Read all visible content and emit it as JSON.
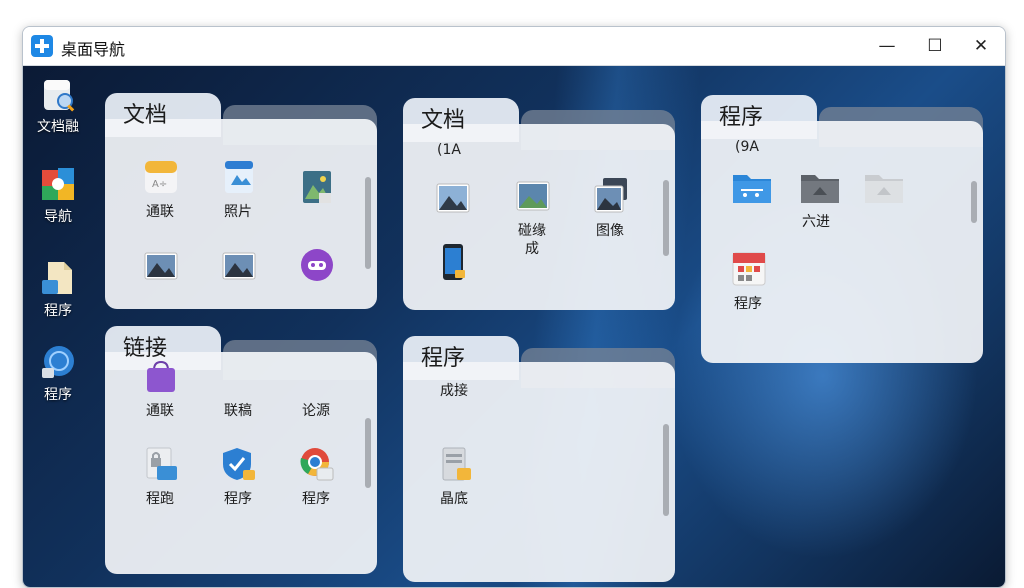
{
  "window": {
    "title": "桌面导航",
    "minimize_glyph": "—",
    "maximize_glyph": "☐",
    "close_glyph": "✕"
  },
  "sidebar": {
    "items": [
      {
        "label": "文档融",
        "icon": "folder-search-icon"
      },
      {
        "label": "导航",
        "icon": "colorful-app-icon"
      },
      {
        "label": "程序",
        "icon": "document-icon"
      },
      {
        "label": "程序",
        "icon": "globe-app-icon"
      }
    ]
  },
  "folders": [
    {
      "title": "文档",
      "subheader": "",
      "items": [
        {
          "label": "通联",
          "icon": "document-icon"
        },
        {
          "label": "照片",
          "icon": "photo-document-icon"
        },
        {
          "label": "",
          "icon": "photo-icon"
        },
        {
          "label": "",
          "icon": "landscape-image-icon"
        },
        {
          "label": "",
          "icon": "landscape-image-icon"
        },
        {
          "label": "",
          "icon": "game-controller-icon"
        }
      ]
    },
    {
      "title": "文档",
      "subheader": "(1A",
      "items": [
        {
          "label": "",
          "icon": "landscape-image-icon"
        },
        {
          "label": "碰缘\n成",
          "icon": "landscape-image-icon"
        },
        {
          "label": "图像",
          "icon": "stacked-images-icon"
        },
        {
          "label": "",
          "icon": "phone-icon"
        }
      ]
    },
    {
      "title": "程序",
      "subheader": "(9A",
      "items": [
        {
          "label": "",
          "icon": "blue-folder-icon"
        },
        {
          "label": "六进",
          "icon": "gray-folder-icon"
        },
        {
          "label": "",
          "icon": "light-folder-icon"
        },
        {
          "label": "程序",
          "icon": "calendar-app-icon"
        }
      ]
    },
    {
      "title": "链接",
      "subheader": "",
      "items": [
        {
          "label": "通联",
          "icon": "shopping-bag-icon"
        },
        {
          "label": "联稿",
          "icon": ""
        },
        {
          "label": "论源",
          "icon": ""
        },
        {
          "label": "程跑",
          "icon": "lock-document-icon"
        },
        {
          "label": "程序",
          "icon": "shield-check-icon"
        },
        {
          "label": "程序",
          "icon": "chrome-app-icon"
        }
      ]
    },
    {
      "title": "程序",
      "subheader": "",
      "items": [
        {
          "label": "成接",
          "icon": ""
        },
        {
          "label": "晶底",
          "icon": "server-icon"
        }
      ]
    }
  ]
}
